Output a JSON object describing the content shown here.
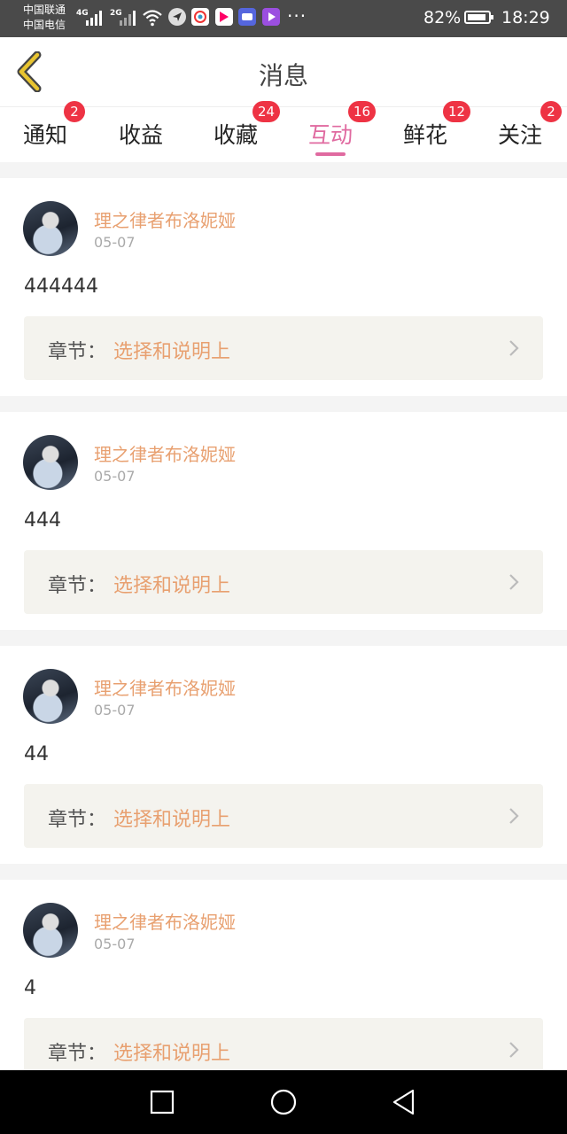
{
  "status_bar": {
    "carrier_1": "中国联通",
    "carrier_2": "中国电信",
    "net_1": "4G",
    "net_2": "2G",
    "battery": "82%",
    "time": "18:29",
    "more": "···",
    "app_icons": [
      "navigation-app-icon",
      "camera-app-icon",
      "video-app-icon",
      "shopping-app-icon",
      "player-app-icon"
    ]
  },
  "header": {
    "title": "消息"
  },
  "tabs": [
    {
      "label": "通知",
      "badge": "2",
      "active": false
    },
    {
      "label": "收益",
      "badge": "",
      "active": false
    },
    {
      "label": "收藏",
      "badge": "24",
      "active": false
    },
    {
      "label": "互动",
      "badge": "16",
      "active": true
    },
    {
      "label": "鲜花",
      "badge": "12",
      "active": false
    },
    {
      "label": "关注",
      "badge": "2",
      "active": false
    }
  ],
  "messages": [
    {
      "user": "理之律者布洛妮娅",
      "date": "05-07",
      "content": "444444",
      "chapter_label": "章节：",
      "chapter_name": "选择和说明上"
    },
    {
      "user": "理之律者布洛妮娅",
      "date": "05-07",
      "content": "444",
      "chapter_label": "章节：",
      "chapter_name": "选择和说明上"
    },
    {
      "user": "理之律者布洛妮娅",
      "date": "05-07",
      "content": "44",
      "chapter_label": "章节：",
      "chapter_name": "选择和说明上"
    },
    {
      "user": "理之律者布洛妮娅",
      "date": "05-07",
      "content": "4",
      "chapter_label": "章节：",
      "chapter_name": "选择和说明上"
    }
  ],
  "colors": {
    "accent": "#e06aa0",
    "username": "#e8a070",
    "badge": "#ee3344",
    "chapter_bg": "#f4f3ee"
  }
}
